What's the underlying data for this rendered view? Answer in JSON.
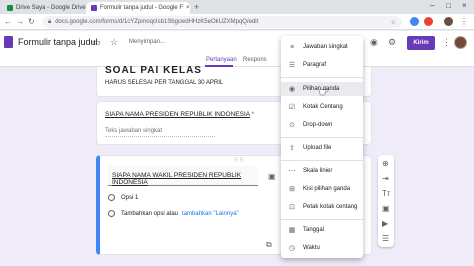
{
  "browser": {
    "tabs": [
      {
        "label": "Drive Saya - Google Drive",
        "close": "×"
      },
      {
        "label": "Formulir tanpa judul - Google F",
        "close": "×"
      }
    ],
    "new_tab": "+",
    "url": "docs.google.com/forms/d/1cYZpmoqcIsb1SbgcwdHHzK5eOkUZXMpqQ/edit"
  },
  "forms": {
    "title": "Formulir tanpa judul",
    "saving_text": "Menyimpan...",
    "send_label": "Kirim",
    "tabs": [
      "Pertanyaan",
      "Respons"
    ]
  },
  "cards": {
    "header_title": "SOAL PAI KELAS",
    "header_text": "HARUS SELESAI PER TANGGAL 30 APRIL",
    "q1_text": "SIAPA NAMA PRESIDEN REPUBLIK INDONESIA",
    "q1_required": "*",
    "q1_answer_placeholder": "Teks jawaban singkat",
    "q2_text": "SIAPA NAMA WAKIL PRESIDEN REPUBLIK INDONESIA",
    "q2_option1": "Opsi 1",
    "q2_add_option": "Tambahkan opsi atau",
    "q2_add_other": "tambahkan \"Lainnya\""
  },
  "question_type_menu": {
    "items": [
      {
        "label": "Jawaban singkat",
        "icon": "short-text-icon",
        "glyph": "≡"
      },
      {
        "label": "Paragraf",
        "icon": "paragraph-icon",
        "glyph": "☰"
      },
      {
        "label": "Pilihan ganda",
        "icon": "radio-icon",
        "glyph": "◉",
        "selected": true
      },
      {
        "label": "Kotak Centang",
        "icon": "checkbox-icon",
        "glyph": "☑"
      },
      {
        "label": "Drop-down",
        "icon": "dropdown-icon",
        "glyph": "⊙"
      },
      {
        "label": "Upload file",
        "icon": "upload-icon",
        "glyph": "⇪"
      },
      {
        "label": "Skala linier",
        "icon": "linear-scale-icon",
        "glyph": "⋯"
      },
      {
        "label": "Kisi pilihan ganda",
        "icon": "grid-icon",
        "glyph": "⊞"
      },
      {
        "label": "Petak kotak centang",
        "icon": "checkbox-grid-icon",
        "glyph": "⊡"
      },
      {
        "label": "Tanggal",
        "icon": "calendar-icon",
        "glyph": "▦"
      },
      {
        "label": "Waktu",
        "icon": "clock-icon",
        "glyph": "◷"
      }
    ]
  },
  "colors": {
    "accent": "#673ab7",
    "active_border": "#4285f4",
    "link": "#1a73e8"
  }
}
